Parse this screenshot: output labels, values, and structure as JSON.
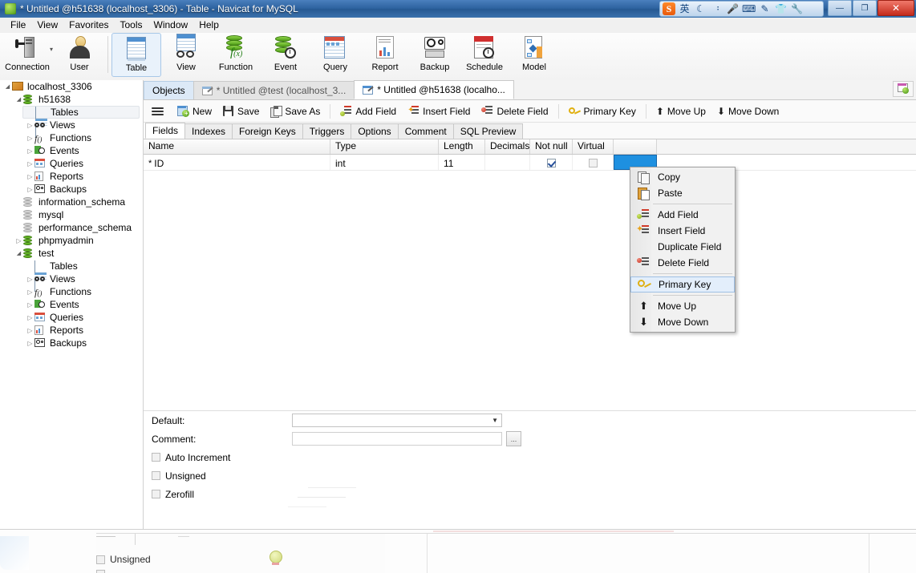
{
  "window": {
    "title": "* Untitled @h51638 (localhost_3306) - Table - Navicat for MySQL",
    "app_icon": "navicat-leaf-icon",
    "minimize": "—",
    "maximize": "❐",
    "close": "✕"
  },
  "ime": {
    "logo": "S",
    "items": [
      "英",
      "☾",
      "᠄",
      "🎤",
      "⌨",
      "✎",
      "👕",
      "🔧"
    ]
  },
  "menubar": {
    "items": [
      "File",
      "View",
      "Favorites",
      "Tools",
      "Window",
      "Help"
    ]
  },
  "toolbar": {
    "buttons": [
      {
        "label": "Connection",
        "icon": "connection-icon",
        "has_dropdown": true,
        "selected": false
      },
      {
        "label": "User",
        "icon": "user-icon",
        "has_dropdown": false,
        "selected": false
      },
      {
        "label": "Table",
        "icon": "table-icon",
        "has_dropdown": false,
        "selected": true
      },
      {
        "label": "View",
        "icon": "view-glasses-icon",
        "has_dropdown": false,
        "selected": false
      },
      {
        "label": "Function",
        "icon": "function-fx-icon",
        "has_dropdown": false,
        "selected": false
      },
      {
        "label": "Event",
        "icon": "event-clock-icon",
        "has_dropdown": false,
        "selected": false
      },
      {
        "label": "Query",
        "icon": "query-icon",
        "has_dropdown": false,
        "selected": false
      },
      {
        "label": "Report",
        "icon": "report-icon",
        "has_dropdown": false,
        "selected": false
      },
      {
        "label": "Backup",
        "icon": "backup-icon",
        "has_dropdown": false,
        "selected": false
      },
      {
        "label": "Schedule",
        "icon": "schedule-calendar-icon",
        "has_dropdown": false,
        "selected": false
      },
      {
        "label": "Model",
        "icon": "model-icon",
        "has_dropdown": false,
        "selected": false
      }
    ]
  },
  "sidebar": {
    "items": [
      {
        "label": "localhost_3306",
        "indent": 0,
        "arrow": "open",
        "icon": "server-icon",
        "selected": false
      },
      {
        "label": "h51638",
        "indent": 1,
        "arrow": "open",
        "icon": "database-icon",
        "selected": false
      },
      {
        "label": "Tables",
        "indent": 2,
        "arrow": "none",
        "icon": "tables-icon",
        "selected": true
      },
      {
        "label": "Views",
        "indent": 2,
        "arrow": "closed",
        "icon": "views-icon",
        "selected": false
      },
      {
        "label": "Functions",
        "indent": 2,
        "arrow": "closed",
        "icon": "functions-icon",
        "selected": false
      },
      {
        "label": "Events",
        "indent": 2,
        "arrow": "closed",
        "icon": "events-icon",
        "selected": false
      },
      {
        "label": "Queries",
        "indent": 2,
        "arrow": "closed",
        "icon": "queries-icon",
        "selected": false
      },
      {
        "label": "Reports",
        "indent": 2,
        "arrow": "closed",
        "icon": "reports-icon",
        "selected": false
      },
      {
        "label": "Backups",
        "indent": 2,
        "arrow": "closed",
        "icon": "backups-icon",
        "selected": false
      },
      {
        "label": "information_schema",
        "indent": 1,
        "arrow": "none",
        "icon": "database-gray-icon",
        "selected": false
      },
      {
        "label": "mysql",
        "indent": 1,
        "arrow": "none",
        "icon": "database-gray-icon",
        "selected": false
      },
      {
        "label": "performance_schema",
        "indent": 1,
        "arrow": "none",
        "icon": "database-gray-icon",
        "selected": false
      },
      {
        "label": "phpmyadmin",
        "indent": 1,
        "arrow": "closed",
        "icon": "database-icon",
        "selected": false
      },
      {
        "label": "test",
        "indent": 1,
        "arrow": "open",
        "icon": "database-icon",
        "selected": false
      },
      {
        "label": "Tables",
        "indent": 2,
        "arrow": "none",
        "icon": "tables-icon",
        "selected": false
      },
      {
        "label": "Views",
        "indent": 2,
        "arrow": "closed",
        "icon": "views-icon",
        "selected": false
      },
      {
        "label": "Functions",
        "indent": 2,
        "arrow": "closed",
        "icon": "functions-icon",
        "selected": false
      },
      {
        "label": "Events",
        "indent": 2,
        "arrow": "closed",
        "icon": "events-icon",
        "selected": false
      },
      {
        "label": "Queries",
        "indent": 2,
        "arrow": "closed",
        "icon": "queries-icon",
        "selected": false
      },
      {
        "label": "Reports",
        "indent": 2,
        "arrow": "closed",
        "icon": "reports-icon",
        "selected": false
      },
      {
        "label": "Backups",
        "indent": 2,
        "arrow": "closed",
        "icon": "backups-icon",
        "selected": false
      }
    ]
  },
  "tabs": {
    "items": [
      {
        "label": "Objects",
        "style": "objects",
        "icon": null
      },
      {
        "label": "* Untitled @test (localhost_3...",
        "style": "inactive",
        "icon": "table-design-icon"
      },
      {
        "label": "* Untitled @h51638 (localho...",
        "style": "active",
        "icon": "table-design-icon"
      }
    ],
    "right_button_icon": "new-object-icon"
  },
  "fieldbar": {
    "menu_icon": "hamburger-icon",
    "buttons": [
      {
        "label": "New",
        "icon": "new-icon"
      },
      {
        "label": "Save",
        "icon": "save-icon"
      },
      {
        "label": "Save As",
        "icon": "save-as-icon"
      },
      {
        "label": "Add Field",
        "icon": "add-field-icon"
      },
      {
        "label": "Insert Field",
        "icon": "insert-field-icon"
      },
      {
        "label": "Delete Field",
        "icon": "delete-field-icon"
      },
      {
        "label": "Primary Key",
        "icon": "key-icon"
      },
      {
        "label": "Move Up",
        "icon": "arrow-up-icon"
      },
      {
        "label": "Move Down",
        "icon": "arrow-down-icon"
      }
    ]
  },
  "subtabs": {
    "items": [
      "Fields",
      "Indexes",
      "Foreign Keys",
      "Triggers",
      "Options",
      "Comment",
      "SQL Preview"
    ],
    "active": "Fields"
  },
  "grid": {
    "columns": [
      "Name",
      "Type",
      "Length",
      "Decimals",
      "Not null",
      "Virtual",
      ""
    ],
    "rows": [
      {
        "marker": "*",
        "name": "ID",
        "type": "int",
        "length": "11",
        "decimals": "",
        "not_null": true,
        "virtual": false,
        "key_cell_selected": true
      }
    ]
  },
  "properties": {
    "default_label": "Default:",
    "default_value": "",
    "comment_label": "Comment:",
    "comment_value": "",
    "comment_browse_label": "...",
    "checkboxes": [
      {
        "label": "Auto Increment",
        "checked": false
      },
      {
        "label": "Unsigned",
        "checked": false
      },
      {
        "label": "Zerofill",
        "checked": false
      }
    ]
  },
  "context_menu": {
    "items": [
      {
        "label": "Copy",
        "icon": "copy-icon",
        "highlighted": false,
        "separator_after": false
      },
      {
        "label": "Paste",
        "icon": "paste-icon",
        "highlighted": false,
        "separator_after": true
      },
      {
        "label": "Add Field",
        "icon": "add-field-icon",
        "highlighted": false,
        "separator_after": false
      },
      {
        "label": "Insert Field",
        "icon": "insert-field-icon",
        "highlighted": false,
        "separator_after": false
      },
      {
        "label": "Duplicate Field",
        "icon": null,
        "highlighted": false,
        "separator_after": false
      },
      {
        "label": "Delete Field",
        "icon": "delete-field-icon",
        "highlighted": false,
        "separator_after": true
      },
      {
        "label": "Primary Key",
        "icon": "key-icon",
        "highlighted": true,
        "separator_after": true
      },
      {
        "label": "Move Up",
        "icon": "arrow-up-icon",
        "highlighted": false,
        "separator_after": false
      },
      {
        "label": "Move Down",
        "icon": "arrow-down-icon",
        "highlighted": false,
        "separator_after": false
      }
    ]
  },
  "background_window": {
    "checkbox_label": "Unsigned"
  },
  "colors": {
    "title_bar": "#2d629f",
    "selected_cell": "#1e90e0",
    "tab_objects": "#dce9f7",
    "menu_highlight": "#e3eefb",
    "db_green": "#63b524"
  }
}
